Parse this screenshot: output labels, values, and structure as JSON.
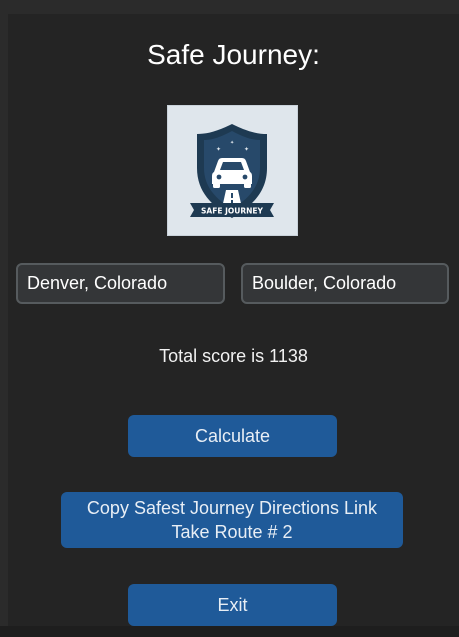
{
  "app": {
    "title": "Safe Journey:",
    "logo_text": "SAFE JOURNEY"
  },
  "inputs": {
    "origin": "Denver, Colorado",
    "destination": "Boulder, Colorado"
  },
  "result": {
    "score_text": "Total score is 1138"
  },
  "buttons": {
    "calculate_label": "Calculate",
    "copy_label_line1": "Copy Safest Journey Directions Link",
    "copy_label_line2": "Take Route # 2",
    "exit_label": "Exit"
  },
  "colors": {
    "background": "#242424",
    "button": "#1f5a99",
    "input_bg": "#343638",
    "input_border": "#565b5e",
    "logo_navy": "#1e3a52"
  }
}
